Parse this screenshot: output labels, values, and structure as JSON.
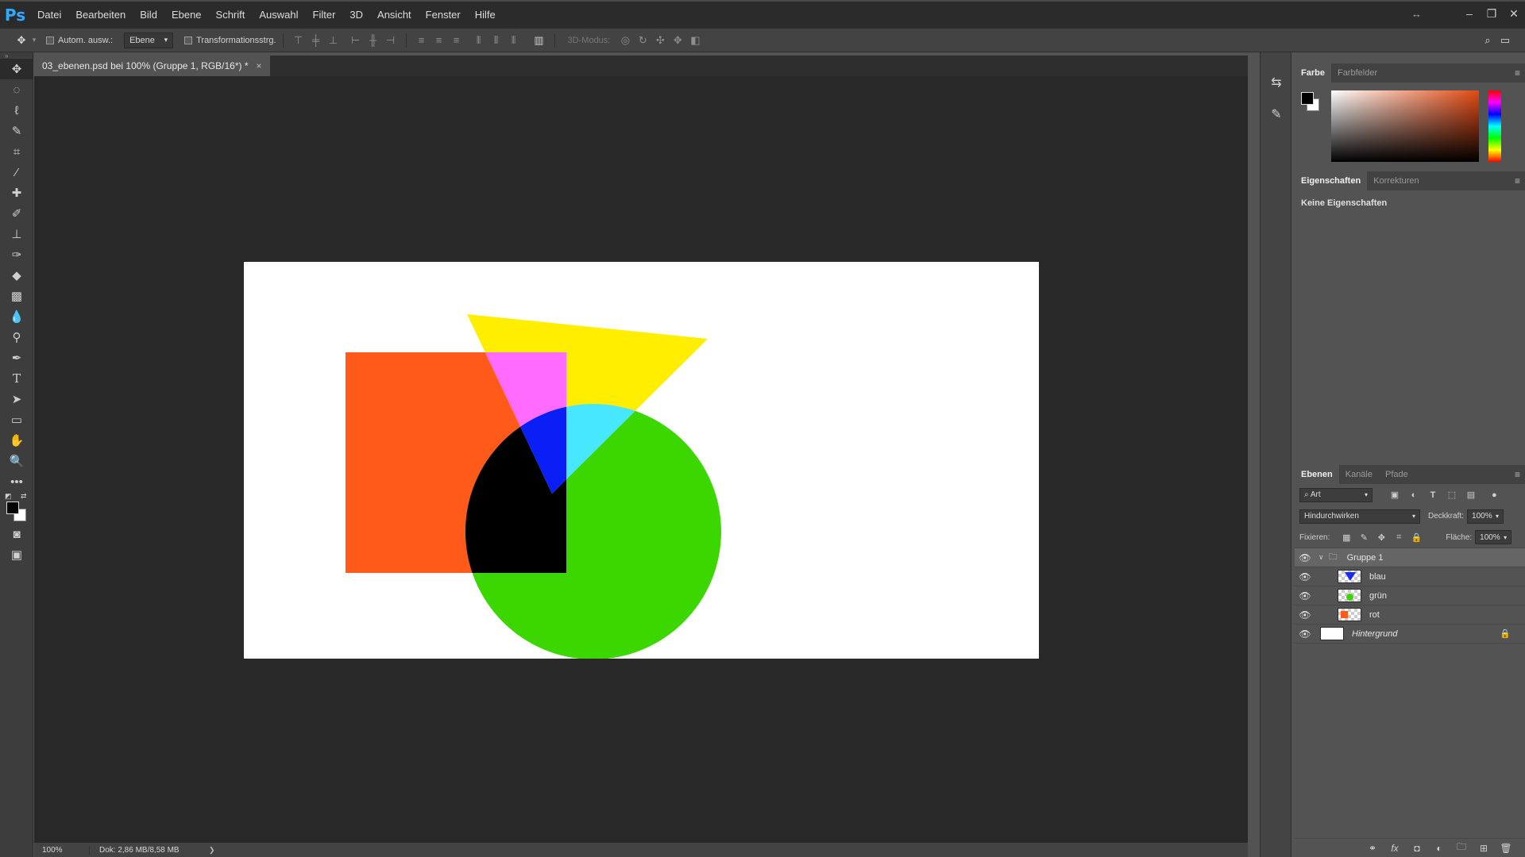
{
  "app": {
    "logo": "Ps"
  },
  "menu": [
    "Datei",
    "Bearbeiten",
    "Bild",
    "Ebene",
    "Schrift",
    "Auswahl",
    "Filter",
    "3D",
    "Ansicht",
    "Fenster",
    "Hilfe"
  ],
  "options": {
    "auto_select_label": "Autom. ausw.:",
    "auto_select_target": "Ebene",
    "transform_label": "Transformationsstrg.",
    "mode_3d_label": "3D-Modus:"
  },
  "document": {
    "tab_title": "03_ebenen.psd bei 100% (Gruppe 1, RGB/16*) *",
    "tab_close": "×",
    "zoom": "100%",
    "doc_info": "Dok: 2,86 MB/8,58 MB",
    "status_arrow": "❯"
  },
  "shapes_colors": {
    "red": "#ff5a19",
    "green": "#3cd600",
    "yellow": "#ffee00",
    "magenta": "#ff6bff",
    "blue": "#0a1ff5",
    "cyan": "#47e8ff",
    "black": "#000000"
  },
  "color_panel": {
    "tabs": [
      "Farbe",
      "Farbfelder"
    ]
  },
  "properties_panel": {
    "tabs": [
      "Eigenschaften",
      "Korrekturen"
    ],
    "empty_text": "Keine Eigenschaften"
  },
  "layers_panel": {
    "tabs": [
      "Ebenen",
      "Kanäle",
      "Pfade"
    ],
    "filter_label": "Art",
    "blend_mode": "Hindurchwirken",
    "opacity_label": "Deckkraft:",
    "opacity_value": "100%",
    "lock_label": "Fixieren:",
    "fill_label": "Fläche:",
    "fill_value": "100%",
    "layers": [
      {
        "name": "Gruppe 1",
        "type": "group"
      },
      {
        "name": "blau",
        "type": "layer"
      },
      {
        "name": "grün",
        "type": "layer"
      },
      {
        "name": "rot",
        "type": "layer"
      },
      {
        "name": "Hintergrund",
        "type": "background"
      }
    ]
  },
  "icons": {
    "eye": "visibility-eye-icon",
    "folder": "folder-icon",
    "lock": "lock-icon"
  }
}
